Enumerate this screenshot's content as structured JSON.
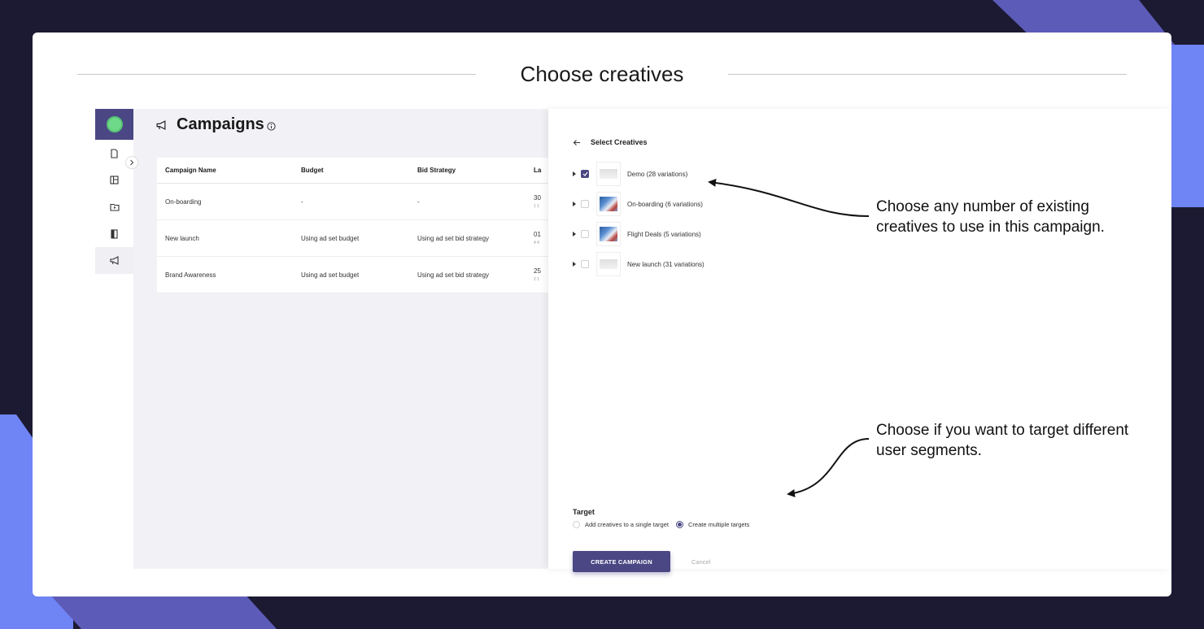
{
  "heading": "Choose creatives",
  "page": {
    "title": "Campaigns"
  },
  "table": {
    "headers": [
      "Campaign Name",
      "Budget",
      "Bid Strategy",
      "La"
    ],
    "rows": [
      {
        "name": "On-boarding",
        "budget": "-",
        "bid": "-",
        "last": "30",
        "last_sub": "1 1"
      },
      {
        "name": "New launch",
        "budget": "Using ad set budget",
        "bid": "Using ad set bid strategy",
        "last": "01",
        "last_sub": "4 4"
      },
      {
        "name": "Brand Awareness",
        "budget": "Using ad set budget",
        "bid": "Using ad set bid strategy",
        "last": "25",
        "last_sub": "2 1"
      }
    ]
  },
  "panel": {
    "title": "Select Creatives",
    "creatives": [
      {
        "label": "Demo (28 variations)",
        "checked": true
      },
      {
        "label": "On-boarding (6 variations)",
        "checked": false
      },
      {
        "label": "Flight Deals (5 variations)",
        "checked": false
      },
      {
        "label": "New launch (31 variations)",
        "checked": false
      }
    ],
    "target_label": "Target",
    "target_options": [
      "Add creatives to a single target",
      "Create multiple targets"
    ],
    "target_selected": "Create multiple targets",
    "create_label": "CREATE CAMPAIGN",
    "cancel_label": "Cancel"
  },
  "annotations": {
    "creatives_note": "Choose any number of existing creatives to use in this campaign.",
    "target_note": "Choose if you want to target different user segments."
  },
  "colors": {
    "accent": "#4a4784",
    "background": "#1c1a32",
    "shape_purple": "#5d5bb8",
    "shape_blue": "#6f84f5"
  }
}
